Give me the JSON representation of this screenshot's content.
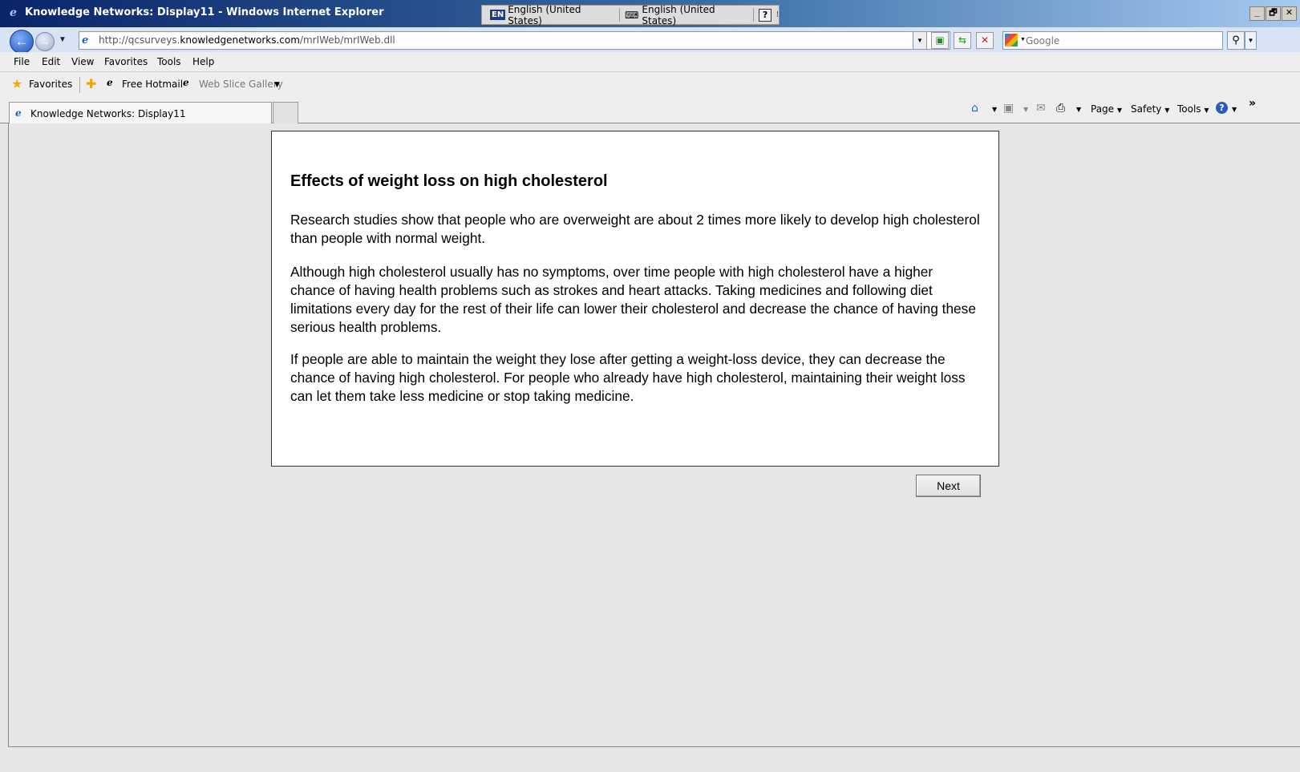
{
  "window": {
    "title": "Knowledge Networks: Display11 - Windows Internet Explorer",
    "controls": [
      "_",
      "🗗",
      "✕"
    ]
  },
  "langbar": {
    "code": "EN",
    "input_language": "English (United States)",
    "keyboard_layout": "English (United States)",
    "help": "?"
  },
  "address": {
    "url_prefix": "http://qcsurveys.",
    "url_host": "knowledgenetworks.com",
    "url_path": "/mrIWeb/mrIWeb.dll",
    "search_placeholder": "Google"
  },
  "menu": [
    "File",
    "Edit",
    "View",
    "Favorites",
    "Tools",
    "Help"
  ],
  "favorites_bar": {
    "favorites_label": "Favorites",
    "links": [
      "Free Hotmail",
      "Web Slice Gallery"
    ]
  },
  "tabs": {
    "active_title": "Knowledge Networks: Display11"
  },
  "command_bar": {
    "page": "Page",
    "safety": "Safety",
    "tools": "Tools",
    "overflow": "»"
  },
  "content": {
    "heading": "Effects of weight loss on high cholesterol",
    "paragraphs": [
      "Research studies show that people who are overweight are about 2 times more likely to develop high cholesterol than people with normal weight.",
      "Although high cholesterol usually has no symptoms, over time people with high cholesterol have a higher chance of having health problems such as strokes and heart attacks. Taking medicines and following diet limitations every day for the rest of their life can lower their cholesterol and decrease the chance of having these serious health problems.",
      "If people are able to maintain the weight they lose after getting a weight-loss device, they can decrease the chance of having high cholesterol. For people who already have high cholesterol, maintaining their weight loss can let them take less medicine or stop taking medicine."
    ],
    "next_button": "Next"
  }
}
